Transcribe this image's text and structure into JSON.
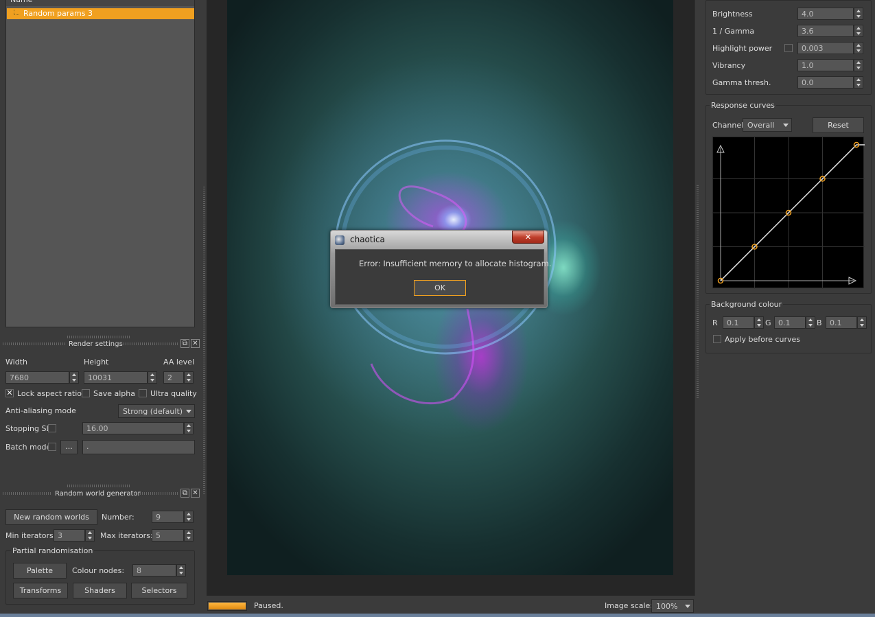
{
  "left": {
    "tree": {
      "header": "Name",
      "items": [
        "Random params 3"
      ]
    },
    "render_settings": {
      "title": "Render settings",
      "width_label": "Width",
      "height_label": "Height",
      "aa_label": "AA level",
      "width": "7680",
      "height": "10031",
      "aa": "2",
      "lock_aspect": "Lock aspect ratio",
      "save_alpha": "Save alpha",
      "ultra_quality": "Ultra quality",
      "aa_mode_label": "Anti-aliasing mode",
      "aa_mode": "Strong (default)",
      "stopping_label": "Stopping SL",
      "stopping_value": "16.00",
      "batch_label": "Batch mode",
      "batch_browse": "...",
      "batch_path": "."
    },
    "random_world": {
      "title": "Random world generator",
      "new_button": "New random worlds",
      "number_label": "Number:",
      "number": "9",
      "min_label": "Min iterators:",
      "min": "3",
      "max_label": "Max iterators:",
      "max": "5",
      "partial_title": "Partial randomisation",
      "palette": "Palette",
      "colour_nodes_label": "Colour nodes:",
      "colour_nodes": "8",
      "transforms": "Transforms",
      "shaders": "Shaders",
      "selectors": "Selectors"
    }
  },
  "status": {
    "text": "Paused.",
    "progress": 1.0,
    "scale_label": "Image scale:",
    "scale": "100%"
  },
  "dialog": {
    "title": "chaotica",
    "message": "Error: Insufficient memory to allocate histogram.",
    "ok": "OK",
    "close": "✕"
  },
  "right": {
    "params": [
      {
        "label": "Brightness",
        "value": "4.0"
      },
      {
        "label": "1 / Gamma",
        "value": "3.6"
      },
      {
        "label": "Highlight power",
        "value": "0.003"
      },
      {
        "label": "Vibrancy",
        "value": "1.0"
      },
      {
        "label": "Gamma thresh.",
        "value": "0.0"
      }
    ],
    "curves": {
      "title": "Response curves",
      "channel_label": "Channel:",
      "channel": "Overall",
      "reset": "Reset",
      "points": [
        [
          0,
          0
        ],
        [
          0.25,
          0.25
        ],
        [
          0.5,
          0.5
        ],
        [
          0.75,
          0.75
        ],
        [
          1,
          1
        ]
      ]
    },
    "background": {
      "title": "Background colour",
      "r_label": "R",
      "g_label": "G",
      "b_label": "B",
      "r": "0.1",
      "g": "0.1",
      "b": "0.1",
      "apply": "Apply before curves"
    }
  },
  "colors": {
    "accent": "#f0a020",
    "panel": "#3b3b3b",
    "field": "#555555"
  }
}
